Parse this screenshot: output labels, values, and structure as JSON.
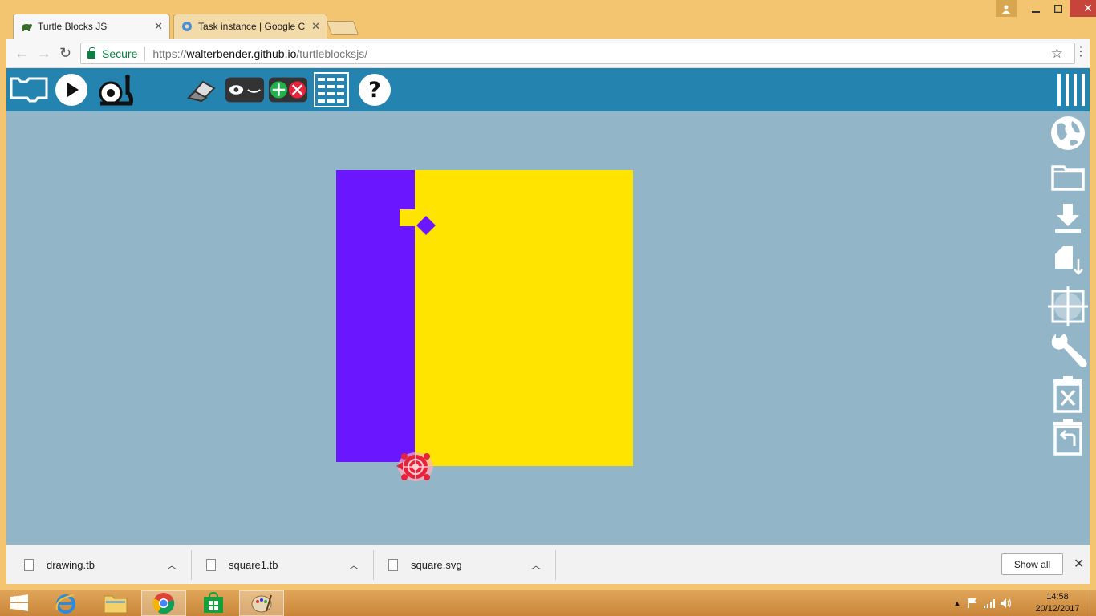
{
  "browser": {
    "tabs": [
      {
        "title": "Turtle Blocks JS",
        "active": true
      },
      {
        "title": "Task instance | Google C",
        "active": false
      }
    ],
    "address": {
      "secure_label": "Secure",
      "url_scheme": "https://",
      "url_host": "walterbender.github.io",
      "url_path": "/turtleblocksjs/"
    }
  },
  "app": {
    "toolbar_icons": [
      "stack-icon",
      "play-icon",
      "snail-icon",
      "eraser-icon",
      "eye-icon",
      "collapse-expand-icon",
      "grid-icon",
      "help-icon"
    ],
    "side_icons": [
      "menu-icon",
      "globe-icon",
      "folder-icon",
      "download-icon",
      "save-file-icon",
      "grid-crosshair-icon",
      "wrench-icon",
      "delete-icon",
      "restore-icon"
    ],
    "colors": {
      "appbar": "#2584af",
      "canvas": "#92b5c8",
      "purple_fill": "#6a17ff",
      "yellow_fill": "#ffe400",
      "turtle": "#e8223b"
    }
  },
  "downloads": {
    "items": [
      "drawing.tb",
      "square1.tb",
      "square.svg"
    ],
    "show_all_label": "Show all"
  },
  "taskbar": {
    "time": "14:58",
    "date": "20/12/2017"
  }
}
